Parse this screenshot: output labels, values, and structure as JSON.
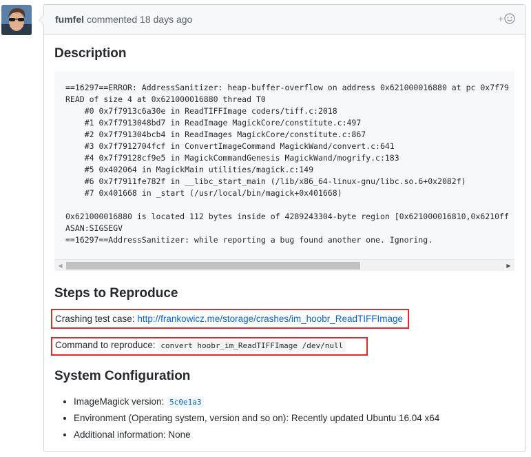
{
  "comment": {
    "author": "fumfel",
    "meta": "commented 18 days ago",
    "reaction_icon": "smiley-icon",
    "reaction_plus": "+"
  },
  "description": {
    "heading": "Description",
    "code_lines": [
      "==16297==ERROR: AddressSanitizer: heap-buffer-overflow on address 0x621000016880 at pc 0x7f79",
      "READ of size 4 at 0x621000016880 thread T0",
      "    #0 0x7f7913c6a30e in ReadTIFFImage coders/tiff.c:2018",
      "    #1 0x7f7913048bd7 in ReadImage MagickCore/constitute.c:497",
      "    #2 0x7f791304bcb4 in ReadImages MagickCore/constitute.c:867",
      "    #3 0x7f7912704fcf in ConvertImageCommand MagickWand/convert.c:641",
      "    #4 0x7f79128cf9e5 in MagickCommandGenesis MagickWand/mogrify.c:183",
      "    #5 0x402064 in MagickMain utilities/magick.c:149",
      "    #6 0x7f7911fe782f in __libc_start_main (/lib/x86_64-linux-gnu/libc.so.6+0x2082f)",
      "    #7 0x401668 in _start (/usr/local/bin/magick+0x401668)",
      "",
      "0x621000016880 is located 112 bytes inside of 4289243304-byte region [0x621000016810,0x6210ff",
      "ASAN:SIGSEGV",
      "==16297==AddressSanitizer: while reporting a bug found another one. Ignoring."
    ]
  },
  "steps": {
    "heading": "Steps to Reproduce",
    "crash_label": "Crashing test case:",
    "crash_link": "http://frankowicz.me/storage/crashes/im_hoobr_ReadTIFFImage",
    "command_label": "Command to reproduce:",
    "command": "convert hoobr_im_ReadTIFFImage /dev/null"
  },
  "system": {
    "heading": "System Configuration",
    "items": [
      {
        "label": "ImageMagick version:",
        "code": "5c0e1a3"
      },
      {
        "label": "Environment (Operating system, version and so on): Recently updated Ubuntu 16.04 x64"
      },
      {
        "label": "Additional information: None"
      }
    ]
  },
  "colors": {
    "highlight_border": "#e0282d",
    "link": "#0366d6"
  }
}
